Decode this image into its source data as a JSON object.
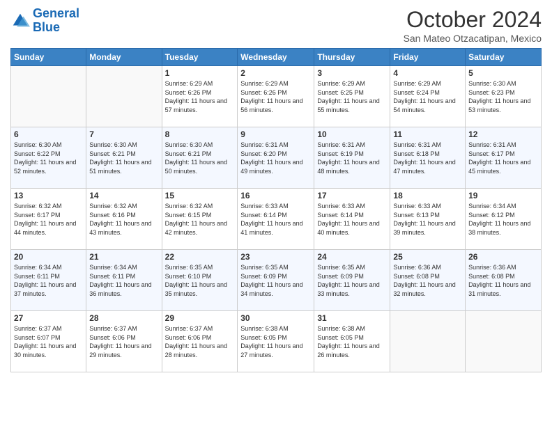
{
  "logo": {
    "line1": "General",
    "line2": "Blue"
  },
  "title": "October 2024",
  "location": "San Mateo Otzacatipan, Mexico",
  "weekdays": [
    "Sunday",
    "Monday",
    "Tuesday",
    "Wednesday",
    "Thursday",
    "Friday",
    "Saturday"
  ],
  "weeks": [
    [
      {
        "day": "",
        "empty": true
      },
      {
        "day": "",
        "empty": true
      },
      {
        "day": "1",
        "sunrise": "6:29 AM",
        "sunset": "6:26 PM",
        "daylight": "11 hours and 57 minutes."
      },
      {
        "day": "2",
        "sunrise": "6:29 AM",
        "sunset": "6:26 PM",
        "daylight": "11 hours and 56 minutes."
      },
      {
        "day": "3",
        "sunrise": "6:29 AM",
        "sunset": "6:25 PM",
        "daylight": "11 hours and 55 minutes."
      },
      {
        "day": "4",
        "sunrise": "6:29 AM",
        "sunset": "6:24 PM",
        "daylight": "11 hours and 54 minutes."
      },
      {
        "day": "5",
        "sunrise": "6:30 AM",
        "sunset": "6:23 PM",
        "daylight": "11 hours and 53 minutes."
      }
    ],
    [
      {
        "day": "6",
        "sunrise": "6:30 AM",
        "sunset": "6:22 PM",
        "daylight": "11 hours and 52 minutes."
      },
      {
        "day": "7",
        "sunrise": "6:30 AM",
        "sunset": "6:21 PM",
        "daylight": "11 hours and 51 minutes."
      },
      {
        "day": "8",
        "sunrise": "6:30 AM",
        "sunset": "6:21 PM",
        "daylight": "11 hours and 50 minutes."
      },
      {
        "day": "9",
        "sunrise": "6:31 AM",
        "sunset": "6:20 PM",
        "daylight": "11 hours and 49 minutes."
      },
      {
        "day": "10",
        "sunrise": "6:31 AM",
        "sunset": "6:19 PM",
        "daylight": "11 hours and 48 minutes."
      },
      {
        "day": "11",
        "sunrise": "6:31 AM",
        "sunset": "6:18 PM",
        "daylight": "11 hours and 47 minutes."
      },
      {
        "day": "12",
        "sunrise": "6:31 AM",
        "sunset": "6:17 PM",
        "daylight": "11 hours and 45 minutes."
      }
    ],
    [
      {
        "day": "13",
        "sunrise": "6:32 AM",
        "sunset": "6:17 PM",
        "daylight": "11 hours and 44 minutes."
      },
      {
        "day": "14",
        "sunrise": "6:32 AM",
        "sunset": "6:16 PM",
        "daylight": "11 hours and 43 minutes."
      },
      {
        "day": "15",
        "sunrise": "6:32 AM",
        "sunset": "6:15 PM",
        "daylight": "11 hours and 42 minutes."
      },
      {
        "day": "16",
        "sunrise": "6:33 AM",
        "sunset": "6:14 PM",
        "daylight": "11 hours and 41 minutes."
      },
      {
        "day": "17",
        "sunrise": "6:33 AM",
        "sunset": "6:14 PM",
        "daylight": "11 hours and 40 minutes."
      },
      {
        "day": "18",
        "sunrise": "6:33 AM",
        "sunset": "6:13 PM",
        "daylight": "11 hours and 39 minutes."
      },
      {
        "day": "19",
        "sunrise": "6:34 AM",
        "sunset": "6:12 PM",
        "daylight": "11 hours and 38 minutes."
      }
    ],
    [
      {
        "day": "20",
        "sunrise": "6:34 AM",
        "sunset": "6:11 PM",
        "daylight": "11 hours and 37 minutes."
      },
      {
        "day": "21",
        "sunrise": "6:34 AM",
        "sunset": "6:11 PM",
        "daylight": "11 hours and 36 minutes."
      },
      {
        "day": "22",
        "sunrise": "6:35 AM",
        "sunset": "6:10 PM",
        "daylight": "11 hours and 35 minutes."
      },
      {
        "day": "23",
        "sunrise": "6:35 AM",
        "sunset": "6:09 PM",
        "daylight": "11 hours and 34 minutes."
      },
      {
        "day": "24",
        "sunrise": "6:35 AM",
        "sunset": "6:09 PM",
        "daylight": "11 hours and 33 minutes."
      },
      {
        "day": "25",
        "sunrise": "6:36 AM",
        "sunset": "6:08 PM",
        "daylight": "11 hours and 32 minutes."
      },
      {
        "day": "26",
        "sunrise": "6:36 AM",
        "sunset": "6:08 PM",
        "daylight": "11 hours and 31 minutes."
      }
    ],
    [
      {
        "day": "27",
        "sunrise": "6:37 AM",
        "sunset": "6:07 PM",
        "daylight": "11 hours and 30 minutes."
      },
      {
        "day": "28",
        "sunrise": "6:37 AM",
        "sunset": "6:06 PM",
        "daylight": "11 hours and 29 minutes."
      },
      {
        "day": "29",
        "sunrise": "6:37 AM",
        "sunset": "6:06 PM",
        "daylight": "11 hours and 28 minutes."
      },
      {
        "day": "30",
        "sunrise": "6:38 AM",
        "sunset": "6:05 PM",
        "daylight": "11 hours and 27 minutes."
      },
      {
        "day": "31",
        "sunrise": "6:38 AM",
        "sunset": "6:05 PM",
        "daylight": "11 hours and 26 minutes."
      },
      {
        "day": "",
        "empty": true
      },
      {
        "day": "",
        "empty": true
      }
    ]
  ]
}
